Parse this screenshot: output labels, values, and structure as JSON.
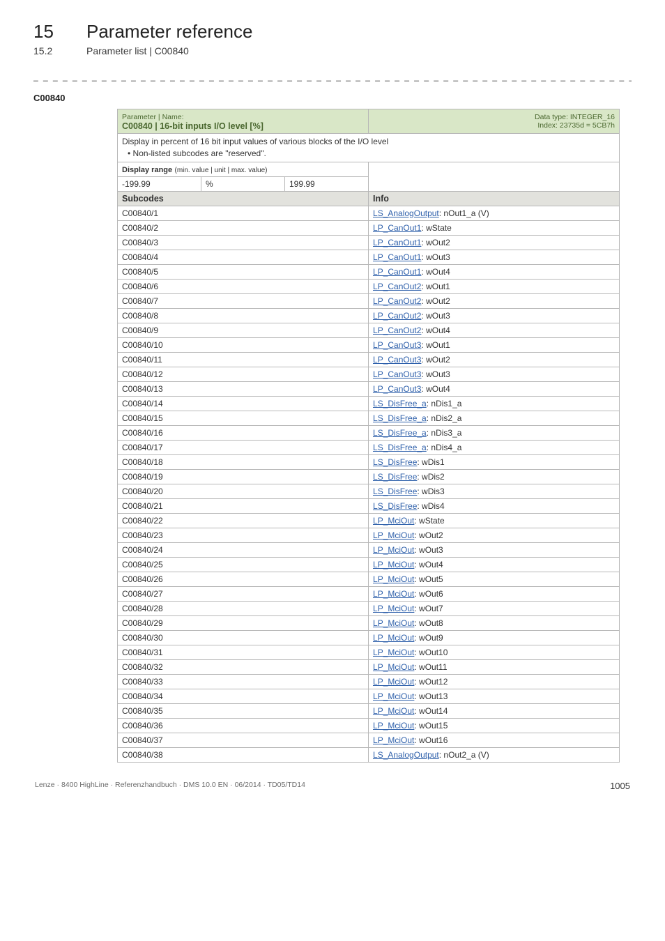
{
  "header": {
    "chapter_number": "15",
    "chapter_title": "Parameter reference",
    "sub_number": "15.2",
    "sub_title": "Parameter list | C00840"
  },
  "param_code": "C00840",
  "param_header": {
    "label": "Parameter | Name:",
    "name": "C00840 | 16-bit inputs I/O level [%]",
    "data_type": "Data type: INTEGER_16",
    "index": "Index: 23735d = 5CB7h"
  },
  "description": {
    "line1": "Display in percent of 16 bit input values of various blocks of the I/O level",
    "bullet": "• Non-listed subcodes are \"reserved\"."
  },
  "display_range": {
    "label": "Display range",
    "paren": "(min. value | unit | max. value)",
    "min": "-199.99",
    "unit": "%",
    "max": "199.99"
  },
  "subcodes_header": {
    "left": "Subcodes",
    "right": "Info"
  },
  "rows": [
    {
      "code": "C00840/1",
      "link": "LS_AnalogOutput",
      "after": ": nOut1_a (V)"
    },
    {
      "code": "C00840/2",
      "link": "LP_CanOut1",
      "after": ": wState"
    },
    {
      "code": "C00840/3",
      "link": "LP_CanOut1",
      "after": ": wOut2"
    },
    {
      "code": "C00840/4",
      "link": "LP_CanOut1",
      "after": ": wOut3"
    },
    {
      "code": "C00840/5",
      "link": "LP_CanOut1",
      "after": ": wOut4"
    },
    {
      "code": "C00840/6",
      "link": "LP_CanOut2",
      "after": ": wOut1"
    },
    {
      "code": "C00840/7",
      "link": "LP_CanOut2",
      "after": ": wOut2"
    },
    {
      "code": "C00840/8",
      "link": "LP_CanOut2",
      "after": ": wOut3"
    },
    {
      "code": "C00840/9",
      "link": "LP_CanOut2",
      "after": ": wOut4"
    },
    {
      "code": "C00840/10",
      "link": "LP_CanOut3",
      "after": ": wOut1"
    },
    {
      "code": "C00840/11",
      "link": "LP_CanOut3",
      "after": ": wOut2"
    },
    {
      "code": "C00840/12",
      "link": "LP_CanOut3",
      "after": ": wOut3"
    },
    {
      "code": "C00840/13",
      "link": "LP_CanOut3",
      "after": ": wOut4"
    },
    {
      "code": "C00840/14",
      "link": "LS_DisFree_a",
      "after": ": nDis1_a"
    },
    {
      "code": "C00840/15",
      "link": "LS_DisFree_a",
      "after": ": nDis2_a"
    },
    {
      "code": "C00840/16",
      "link": "LS_DisFree_a",
      "after": ": nDis3_a"
    },
    {
      "code": "C00840/17",
      "link": "LS_DisFree_a",
      "after": ": nDis4_a"
    },
    {
      "code": "C00840/18",
      "link": "LS_DisFree",
      "after": ": wDis1"
    },
    {
      "code": "C00840/19",
      "link": "LS_DisFree",
      "after": ": wDis2"
    },
    {
      "code": "C00840/20",
      "link": "LS_DisFree",
      "after": ": wDis3"
    },
    {
      "code": "C00840/21",
      "link": "LS_DisFree",
      "after": ": wDis4"
    },
    {
      "code": "C00840/22",
      "link": "LP_MciOut",
      "after": ": wState"
    },
    {
      "code": "C00840/23",
      "link": "LP_MciOut",
      "after": ": wOut2"
    },
    {
      "code": "C00840/24",
      "link": "LP_MciOut",
      "after": ": wOut3"
    },
    {
      "code": "C00840/25",
      "link": "LP_MciOut",
      "after": ": wOut4"
    },
    {
      "code": "C00840/26",
      "link": "LP_MciOut",
      "after": ": wOut5"
    },
    {
      "code": "C00840/27",
      "link": "LP_MciOut",
      "after": ": wOut6"
    },
    {
      "code": "C00840/28",
      "link": "LP_MciOut",
      "after": ": wOut7"
    },
    {
      "code": "C00840/29",
      "link": "LP_MciOut",
      "after": ": wOut8"
    },
    {
      "code": "C00840/30",
      "link": "LP_MciOut",
      "after": ": wOut9"
    },
    {
      "code": "C00840/31",
      "link": "LP_MciOut",
      "after": ": wOut10"
    },
    {
      "code": "C00840/32",
      "link": "LP_MciOut",
      "after": ": wOut11"
    },
    {
      "code": "C00840/33",
      "link": "LP_MciOut",
      "after": ": wOut12"
    },
    {
      "code": "C00840/34",
      "link": "LP_MciOut",
      "after": ": wOut13"
    },
    {
      "code": "C00840/35",
      "link": "LP_MciOut",
      "after": ": wOut14"
    },
    {
      "code": "C00840/36",
      "link": "LP_MciOut",
      "after": ": wOut15"
    },
    {
      "code": "C00840/37",
      "link": "LP_MciOut",
      "after": ": wOut16"
    },
    {
      "code": "C00840/38",
      "link": "LS_AnalogOutput",
      "after": ": nOut2_a (V)"
    }
  ],
  "footer": {
    "left": "Lenze · 8400 HighLine · Referenzhandbuch · DMS 10.0 EN · 06/2014 · TD05/TD14",
    "page": "1005"
  }
}
